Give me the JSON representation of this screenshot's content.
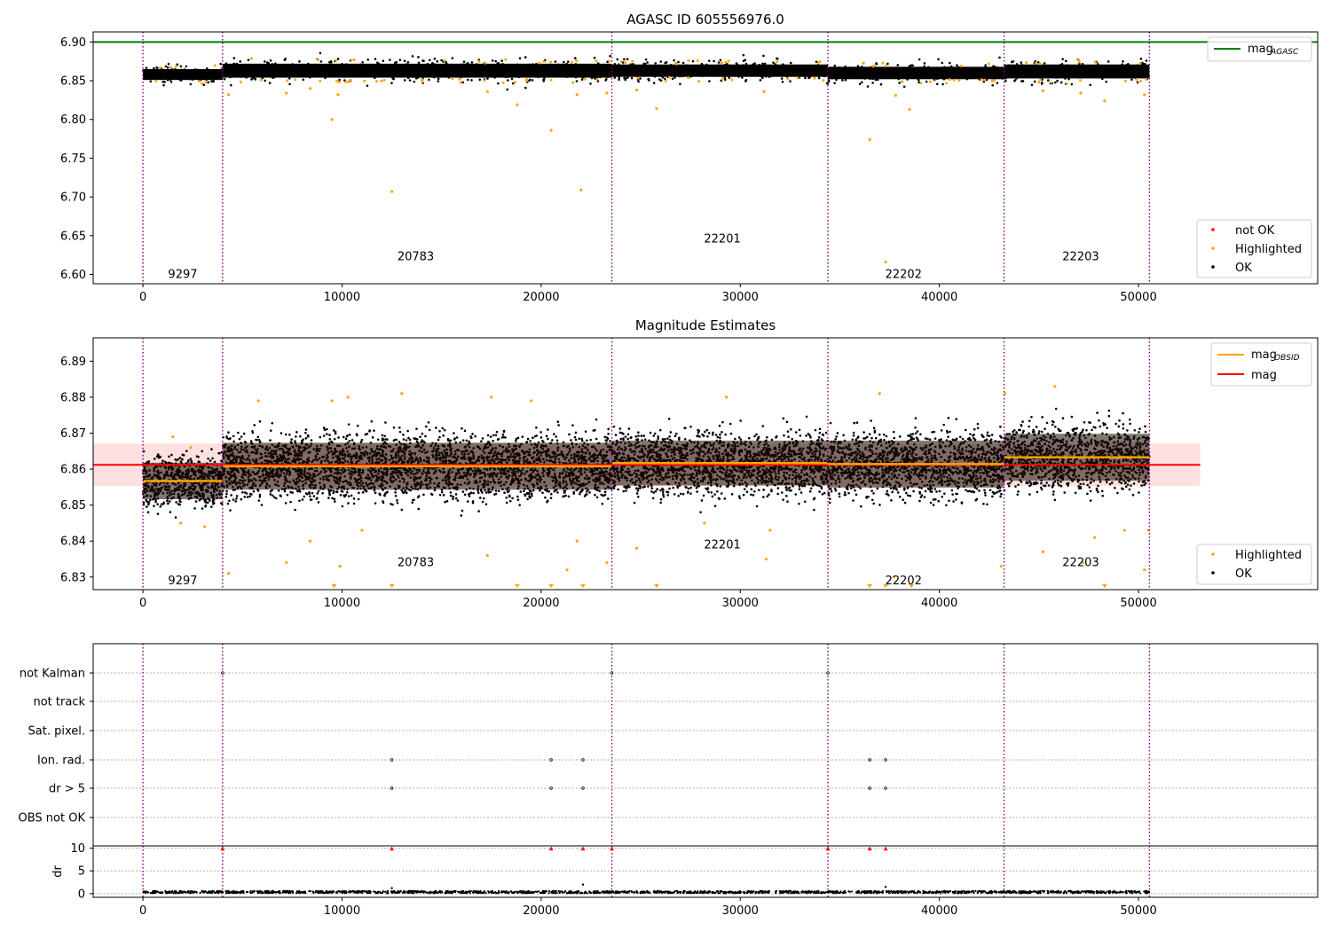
{
  "chart_data": [
    {
      "type": "scatter",
      "title": "AGASC ID 605556976.0",
      "xlim": [
        -2500,
        59000
      ],
      "ylim": [
        6.588,
        6.913
      ],
      "x_ticks": [
        "0",
        "10000",
        "20000",
        "30000",
        "40000",
        "50000"
      ],
      "y_ticks": [
        "6.60",
        "6.65",
        "6.70",
        "6.75",
        "6.80",
        "6.85",
        "6.90"
      ],
      "obsid_boundaries": [
        0,
        4000,
        23550,
        34400,
        43250,
        50550
      ],
      "obsid_labels": [
        {
          "text": "9297",
          "x": 2000,
          "y": 6.6
        },
        {
          "text": "20783",
          "x": 13700,
          "y": 6.623
        },
        {
          "text": "22201",
          "x": 29100,
          "y": 6.646
        },
        {
          "text": "22202",
          "x": 38200,
          "y": 6.6
        },
        {
          "text": "22203",
          "x": 47100,
          "y": 6.623
        }
      ],
      "mag_agasc": 6.9,
      "segments": [
        {
          "x0": 0,
          "x1": 4000,
          "center": 6.858,
          "spread": 0.007
        },
        {
          "x0": 4000,
          "x1": 23550,
          "center": 6.863,
          "spread": 0.009
        },
        {
          "x0": 23550,
          "x1": 34400,
          "center": 6.863,
          "spread": 0.008
        },
        {
          "x0": 34400,
          "x1": 43250,
          "center": 6.86,
          "spread": 0.008
        },
        {
          "x0": 43250,
          "x1": 50550,
          "center": 6.862,
          "spread": 0.009
        }
      ],
      "highlighted_points": [
        [
          9500,
          6.8
        ],
        [
          12500,
          6.707
        ],
        [
          18800,
          6.819
        ],
        [
          20500,
          6.786
        ],
        [
          22000,
          6.709
        ],
        [
          25800,
          6.814
        ],
        [
          36500,
          6.774
        ],
        [
          37300,
          6.616
        ],
        [
          38500,
          6.813
        ],
        [
          48300,
          6.824
        ],
        [
          4300,
          6.832
        ],
        [
          7200,
          6.834
        ],
        [
          8400,
          6.84
        ],
        [
          9800,
          6.832
        ],
        [
          17300,
          6.836
        ],
        [
          21800,
          6.832
        ],
        [
          23300,
          6.834
        ],
        [
          24800,
          6.838
        ],
        [
          31200,
          6.836
        ],
        [
          37800,
          6.831
        ],
        [
          45200,
          6.837
        ],
        [
          47100,
          6.834
        ],
        [
          50300,
          6.832
        ]
      ],
      "legend_lines": [
        {
          "name": "mag",
          "sub": "AGASC",
          "color": "#008000"
        }
      ],
      "legend_points": [
        {
          "name": "not OK",
          "color": "#ff0000"
        },
        {
          "name": "Highlighted",
          "color": "#ffa500"
        },
        {
          "name": "OK",
          "color": "#000000"
        }
      ]
    },
    {
      "type": "scatter",
      "title": "Magnitude Estimates",
      "xlim": [
        -2500,
        59000
      ],
      "ylim": [
        6.8265,
        6.8965
      ],
      "x_ticks": [
        "0",
        "10000",
        "20000",
        "30000",
        "40000",
        "50000"
      ],
      "y_ticks": [
        "6.83",
        "6.84",
        "6.85",
        "6.86",
        "6.87",
        "6.88",
        "6.89"
      ],
      "obsid_boundaries": [
        0,
        4000,
        23550,
        34400,
        43250,
        50550
      ],
      "obsid_labels": [
        {
          "text": "9297",
          "x": 2000,
          "y": 6.829
        },
        {
          "text": "20783",
          "x": 13700,
          "y": 6.834
        },
        {
          "text": "22201",
          "x": 29100,
          "y": 6.839
        },
        {
          "text": "22202",
          "x": 38200,
          "y": 6.829
        },
        {
          "text": "22203",
          "x": 47100,
          "y": 6.834
        }
      ],
      "mag": 6.8612,
      "mag_band": [
        6.8553,
        6.8671
      ],
      "mag_obsid": [
        {
          "x0": 0,
          "x1": 4000,
          "value": 6.8567
        },
        {
          "x0": 4000,
          "x1": 23550,
          "value": 6.8608
        },
        {
          "x0": 23550,
          "x1": 34400,
          "value": 6.8617
        },
        {
          "x0": 34400,
          "x1": 43250,
          "value": 6.8614
        },
        {
          "x0": 43250,
          "x1": 50550,
          "value": 6.8633
        }
      ],
      "segments": [
        {
          "x0": 0,
          "x1": 4000,
          "center": 6.8567,
          "spread": 0.0035,
          "lo": 6.846,
          "hi": 6.866
        },
        {
          "x0": 4000,
          "x1": 23550,
          "center": 6.8608,
          "spread": 0.0045,
          "lo": 6.845,
          "hi": 6.877
        },
        {
          "x0": 23550,
          "x1": 34400,
          "center": 6.8617,
          "spread": 0.0043,
          "lo": 6.847,
          "hi": 6.876
        },
        {
          "x0": 34400,
          "x1": 43250,
          "center": 6.8614,
          "spread": 0.0045,
          "lo": 6.846,
          "hi": 6.877
        },
        {
          "x0": 43250,
          "x1": 50550,
          "center": 6.8633,
          "spread": 0.0045,
          "lo": 6.847,
          "hi": 6.88
        }
      ],
      "highlighted_points": [
        [
          1500,
          6.869
        ],
        [
          1900,
          6.845
        ],
        [
          2400,
          6.866
        ],
        [
          3100,
          6.844
        ],
        [
          4300,
          6.831
        ],
        [
          5800,
          6.879
        ],
        [
          7200,
          6.834
        ],
        [
          8400,
          6.84
        ],
        [
          9500,
          6.879
        ],
        [
          9900,
          6.833
        ],
        [
          10300,
          6.88
        ],
        [
          11000,
          6.843
        ],
        [
          13000,
          6.881
        ],
        [
          17300,
          6.836
        ],
        [
          17500,
          6.88
        ],
        [
          19500,
          6.879
        ],
        [
          21300,
          6.832
        ],
        [
          21800,
          6.84
        ],
        [
          23300,
          6.834
        ],
        [
          24800,
          6.838
        ],
        [
          28200,
          6.845
        ],
        [
          29300,
          6.88
        ],
        [
          31300,
          6.835
        ],
        [
          31500,
          6.843
        ],
        [
          37000,
          6.881
        ],
        [
          37700,
          6.83
        ],
        [
          43100,
          6.833
        ],
        [
          43300,
          6.881
        ],
        [
          45200,
          6.837
        ],
        [
          45800,
          6.883
        ],
        [
          47200,
          6.834
        ],
        [
          47800,
          6.841
        ],
        [
          49300,
          6.843
        ],
        [
          50300,
          6.832
        ],
        [
          50500,
          6.843
        ]
      ],
      "below_axis_markers": [
        9600,
        12500,
        18800,
        20500,
        22100,
        25800,
        36500,
        37300,
        38600,
        48300
      ],
      "legend_lines": [
        {
          "name": "mag",
          "sub": "OBSID",
          "color": "#ffa500"
        },
        {
          "name": "mag",
          "sub": "",
          "color": "#ff0000"
        }
      ],
      "legend_points": [
        {
          "name": "Highlighted",
          "color": "#ffa500"
        },
        {
          "name": "OK",
          "color": "#000000"
        }
      ]
    },
    {
      "type": "scatter",
      "xlim": [
        -2500,
        59000
      ],
      "x_ticks": [
        "0",
        "10000",
        "20000",
        "30000",
        "40000",
        "50000"
      ],
      "flag_rows": [
        "not Kalman",
        "not track",
        "Sat. pixel.",
        "Ion. rad.",
        "dr > 5",
        "OBS not OK"
      ],
      "obsid_boundaries": [
        0,
        4000,
        23550,
        34400,
        43250,
        50550
      ],
      "flag_points": [
        {
          "row": "not Kalman",
          "x": [
            4000,
            23550,
            34400
          ]
        },
        {
          "row": "Ion. rad.",
          "x": [
            12500,
            20500,
            22100,
            36500,
            37300
          ]
        },
        {
          "row": "dr > 5",
          "x": [
            12500,
            20500,
            22100,
            36500,
            37300
          ]
        }
      ],
      "dr_ylabel": "dr",
      "dr_ylim": [
        -0.8,
        10.5
      ],
      "dr_ticks": [
        "0",
        "5",
        "10"
      ],
      "dr_outliers": [
        {
          "x": 4000,
          "y": 10
        },
        {
          "x": 12500,
          "y": 10
        },
        {
          "x": 20500,
          "y": 10
        },
        {
          "x": 22100,
          "y": 10
        },
        {
          "x": 23550,
          "y": 10
        },
        {
          "x": 34400,
          "y": 10
        },
        {
          "x": 36500,
          "y": 10
        },
        {
          "x": 37300,
          "y": 10
        }
      ],
      "dr_small": [
        [
          12500,
          1.2
        ],
        [
          22100,
          2.0
        ],
        [
          37300,
          1.5
        ],
        [
          4300,
          0.6
        ]
      ]
    }
  ]
}
